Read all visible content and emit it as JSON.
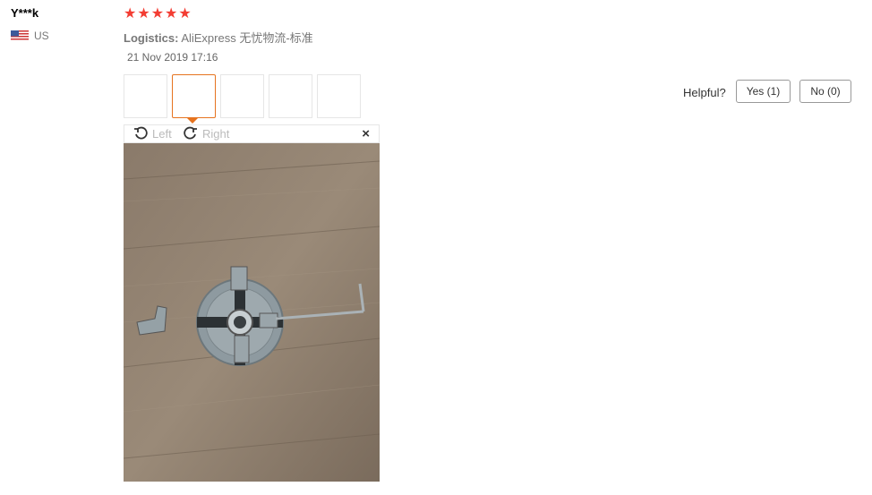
{
  "review": {
    "user": "Y***k",
    "country": "US",
    "rating": 5,
    "stars": [
      "★",
      "★",
      "★",
      "★",
      "★"
    ],
    "logistics_label": "Logistics:",
    "logistics_value": "AliExpress 无忧物流-标准",
    "date": "21 Nov 2019 17:16",
    "thumbnail_count": 5,
    "active_thumbnail": 2
  },
  "helpful": {
    "label": "Helpful?",
    "yes": "Yes (1)",
    "no": "No (0)"
  },
  "viewer": {
    "rotate_left": "Left",
    "rotate_right": "Right",
    "close": "×",
    "image_subject": "metal 4-jaw lathe chuck with separate jaw and hex key on wooden floor"
  },
  "colors": {
    "star": "#f33d33",
    "active_border": "#e6731f"
  }
}
